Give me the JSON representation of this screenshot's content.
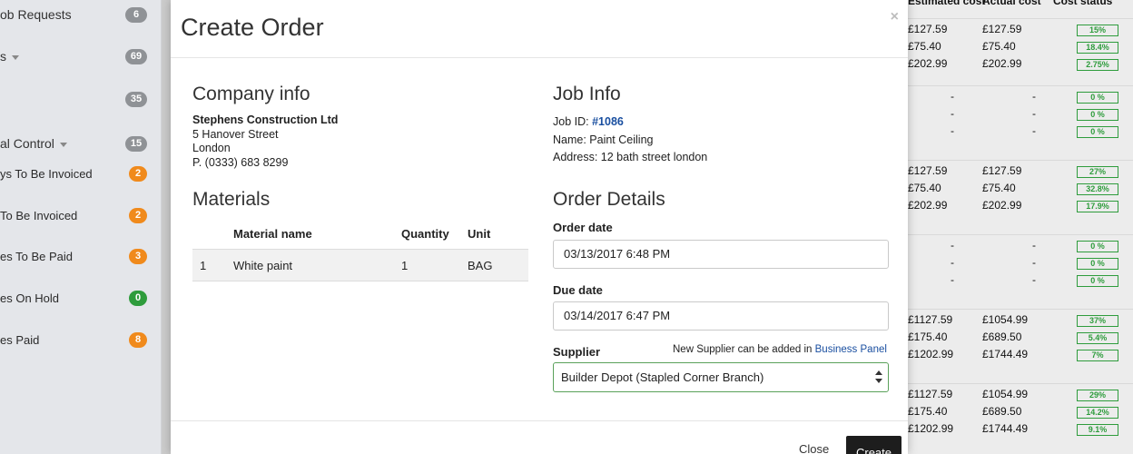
{
  "sidebar": {
    "items": [
      {
        "label": "ob Requests",
        "count": "6",
        "count_color": "grey",
        "caret": false,
        "major": true
      },
      {
        "label": "s",
        "count": "69",
        "count_color": "grey",
        "caret": true,
        "major": true
      },
      {
        "label": "",
        "count": "35",
        "count_color": "grey",
        "caret": false,
        "major": true
      },
      {
        "label": "al Control",
        "count": "15",
        "count_color": "grey",
        "caret": true,
        "major": true
      },
      {
        "label": "ys To Be Invoiced",
        "count": "2",
        "count_color": "orange",
        "caret": false,
        "major": false
      },
      {
        "label": "To Be Invoiced",
        "count": "2",
        "count_color": "orange",
        "caret": false,
        "major": false
      },
      {
        "label": "es To Be Paid",
        "count": "3",
        "count_color": "orange",
        "caret": false,
        "major": false
      },
      {
        "label": "es On Hold",
        "count": "0",
        "count_color": "green",
        "caret": false,
        "major": false
      },
      {
        "label": "es Paid",
        "count": "8",
        "count_color": "orange",
        "caret": false,
        "major": false
      }
    ]
  },
  "background_table": {
    "headers": {
      "estimated": "Estimated cost",
      "actual": "Actual cost",
      "status": "Cost status"
    },
    "groups": [
      {
        "rows": [
          {
            "est": "£127.59",
            "act": "£127.59",
            "pct": "15%"
          },
          {
            "est": "£75.40",
            "act": "£75.40",
            "pct": "18.4%"
          },
          {
            "est": "£202.99",
            "act": "£202.99",
            "pct": "2.75%"
          }
        ]
      },
      {
        "rows": [
          {
            "est": "-",
            "act": "-",
            "pct": "0 %"
          },
          {
            "est": "-",
            "act": "-",
            "pct": "0 %"
          },
          {
            "est": "-",
            "act": "-",
            "pct": "0 %"
          }
        ]
      },
      {
        "rows": [
          {
            "est": "£127.59",
            "act": "£127.59",
            "pct": "27%"
          },
          {
            "est": "£75.40",
            "act": "£75.40",
            "pct": "32.8%"
          },
          {
            "est": "£202.99",
            "act": "£202.99",
            "pct": "17.9%"
          }
        ]
      },
      {
        "rows": [
          {
            "est": "-",
            "act": "-",
            "pct": "0 %"
          },
          {
            "est": "-",
            "act": "-",
            "pct": "0 %"
          },
          {
            "est": "-",
            "act": "-",
            "pct": "0 %"
          }
        ]
      },
      {
        "rows": [
          {
            "est": "£1127.59",
            "act": "£1054.99",
            "pct": "37%"
          },
          {
            "est": "£175.40",
            "act": "£689.50",
            "pct": "5.4%"
          },
          {
            "est": "£1202.99",
            "act": "£1744.49",
            "pct": "7%"
          }
        ]
      },
      {
        "rows": [
          {
            "est": "£1127.59",
            "act": "£1054.99",
            "pct": "29%"
          },
          {
            "est": "£175.40",
            "act": "£689.50",
            "pct": "14.2%"
          },
          {
            "est": "£1202.99",
            "act": "£1744.49",
            "pct": "9.1%"
          }
        ]
      }
    ]
  },
  "modal": {
    "title": "Create Order",
    "close_symbol": "×",
    "company": {
      "heading": "Company info",
      "name": "Stephens Construction Ltd",
      "street": "5 Hanover Street",
      "city": "London",
      "phone": "P. (0333) 683 8299"
    },
    "materials": {
      "heading": "Materials",
      "columns": {
        "name": "Material name",
        "quantity": "Quantity",
        "unit": "Unit"
      },
      "rows": [
        {
          "index": "1",
          "name": "White paint",
          "quantity": "1",
          "unit": "BAG"
        }
      ]
    },
    "job": {
      "heading": "Job Info",
      "id_label": "Job ID:",
      "id_value": "#1086",
      "name_line": "Name: Paint Ceiling",
      "address_line": "Address: 12 bath street london"
    },
    "order": {
      "heading": "Order Details",
      "order_date_label": "Order date",
      "order_date_value": "03/13/2017 6:48 PM",
      "due_date_label": "Due date",
      "due_date_value": "03/14/2017 6:47 PM",
      "supplier_label": "Supplier",
      "supplier_hint": "New Supplier can be added in",
      "supplier_hint_link": "Business Panel",
      "supplier_value": "Builder Depot (Stapled Corner Branch)"
    },
    "footer": {
      "close_label": "Close",
      "create_label": "Create"
    }
  },
  "colors": {
    "badge_grey": "#8f9296",
    "badge_orange": "#f08a1c",
    "badge_green": "#2e9c3c",
    "link_blue": "#1a4fa0",
    "create_button": "#1d1d1d"
  }
}
